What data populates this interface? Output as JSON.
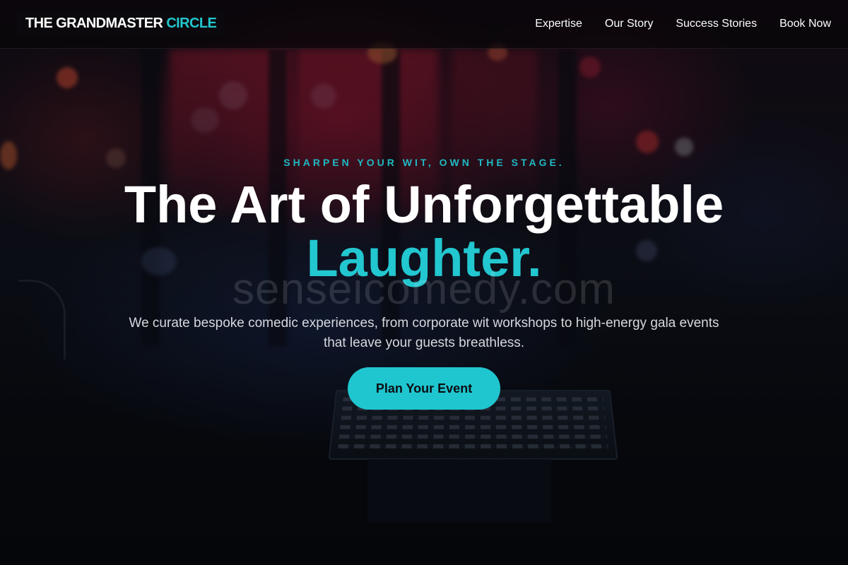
{
  "brand": {
    "name": "THE GRANDMASTER",
    "accent": "CIRCLE",
    "accent_color": "#22c7d0"
  },
  "nav": {
    "items": [
      {
        "label": "Expertise"
      },
      {
        "label": "Our Story"
      },
      {
        "label": "Success Stories"
      },
      {
        "label": "Book Now"
      }
    ]
  },
  "hero": {
    "eyebrow": "SHARPEN YOUR WIT, OWN THE STAGE.",
    "title_line1": "The Art of Unforgettable",
    "title_line2": "Laughter.",
    "subtitle": "We curate bespoke comedic experiences, from corporate wit workshops to high-energy gala events that leave your guests breathless.",
    "cta_label": "Plan Your Event",
    "watermark": "senseicomedy.com"
  }
}
